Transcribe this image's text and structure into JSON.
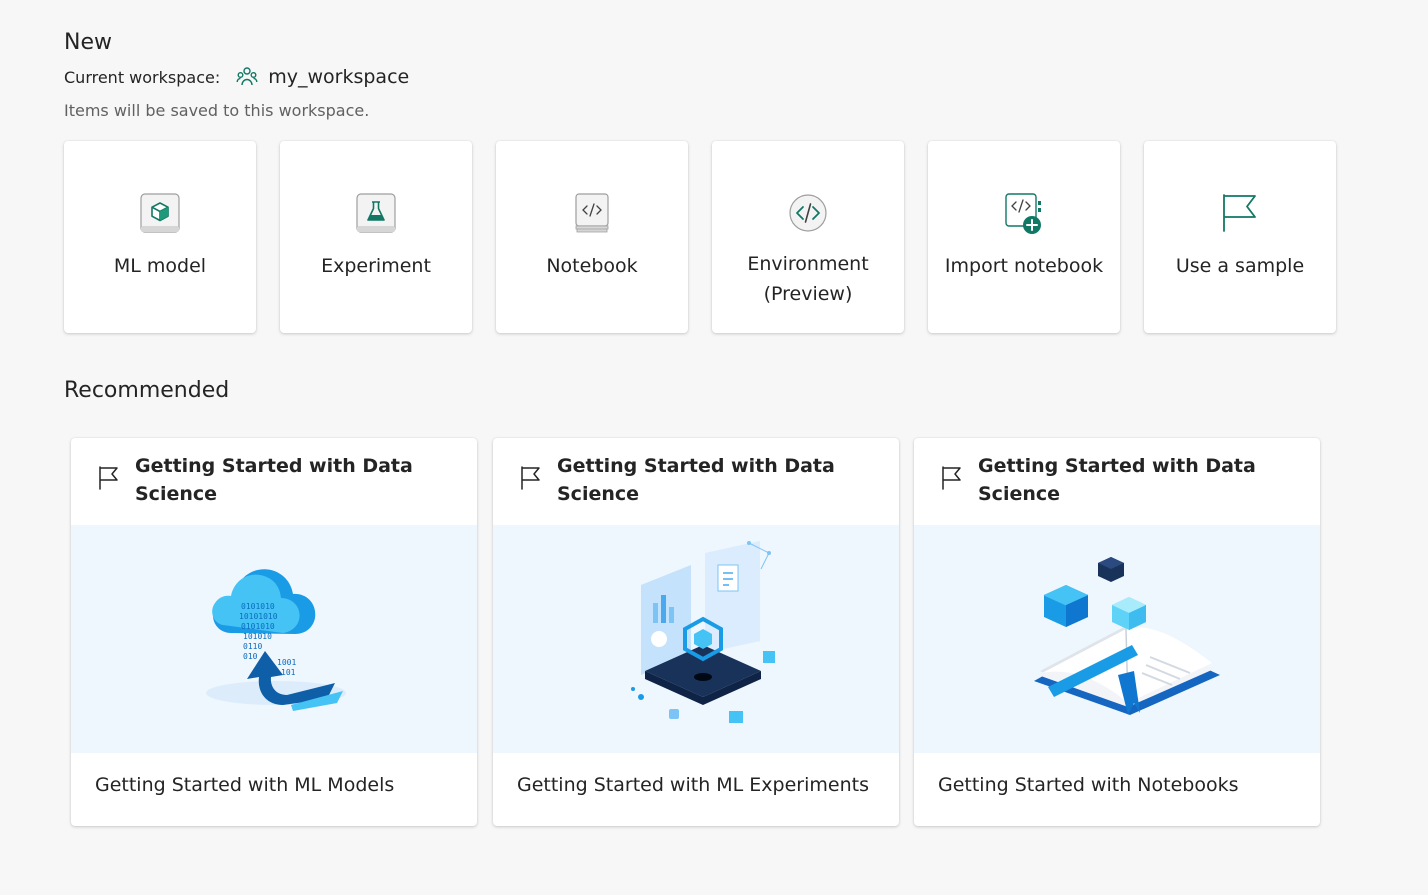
{
  "header": {
    "title": "New",
    "workspace_label": "Current workspace:",
    "workspace_icon": "workspace-people-icon",
    "workspace_name": "my_workspace",
    "hint": "Items will be saved to this workspace."
  },
  "new_items": [
    {
      "label": "ML model",
      "icon": "ml-model-cube-icon"
    },
    {
      "label": "Experiment",
      "icon": "experiment-flask-icon"
    },
    {
      "label": "Notebook",
      "icon": "notebook-icon"
    },
    {
      "label": "Environment (Preview)",
      "icon": "environment-code-icon"
    },
    {
      "label": "Import notebook",
      "icon": "import-notebook-icon"
    },
    {
      "label": "Use a sample",
      "icon": "flag-icon"
    }
  ],
  "recommended": {
    "title": "Recommended",
    "cards": [
      {
        "heading": "Getting Started with Data Science",
        "footer": "Getting Started with ML Models",
        "illustration": "cloud-upload-illustration"
      },
      {
        "heading": "Getting Started with Data Science",
        "footer": "Getting Started with ML Experiments",
        "illustration": "data-platform-illustration"
      },
      {
        "heading": "Getting Started with Data Science",
        "footer": "Getting Started with Notebooks",
        "illustration": "book-cubes-illustration"
      }
    ]
  },
  "colors": {
    "accent_green": "#117865",
    "background": "#f7f7f7",
    "illustration_bg": "#eef6fe"
  }
}
